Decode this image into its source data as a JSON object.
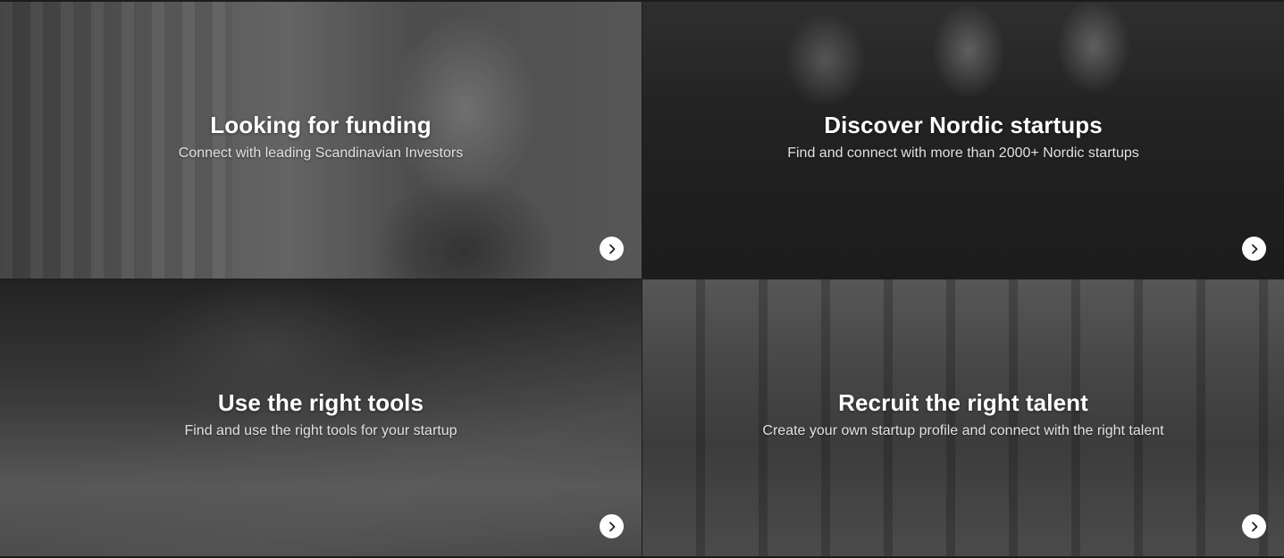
{
  "tiles": [
    {
      "title": "Looking for funding",
      "subtitle": "Connect with leading Scandinavian Investors",
      "icon": "chevron-right-icon"
    },
    {
      "title": "Discover Nordic startups",
      "subtitle": "Find and connect with more than 2000+ Nordic startups",
      "icon": "chevron-right-icon"
    },
    {
      "title": "Use the right tools",
      "subtitle": "Find and use the right tools for your startup",
      "icon": "chevron-right-icon"
    },
    {
      "title": "Recruit the right talent",
      "subtitle": "Create your own startup profile and connect with the right talent",
      "icon": "chevron-right-icon"
    }
  ],
  "colors": {
    "title": "#ffffff",
    "subtitle": "#e2e2e2",
    "button_bg": "#ffffff",
    "button_icon": "#222222"
  }
}
